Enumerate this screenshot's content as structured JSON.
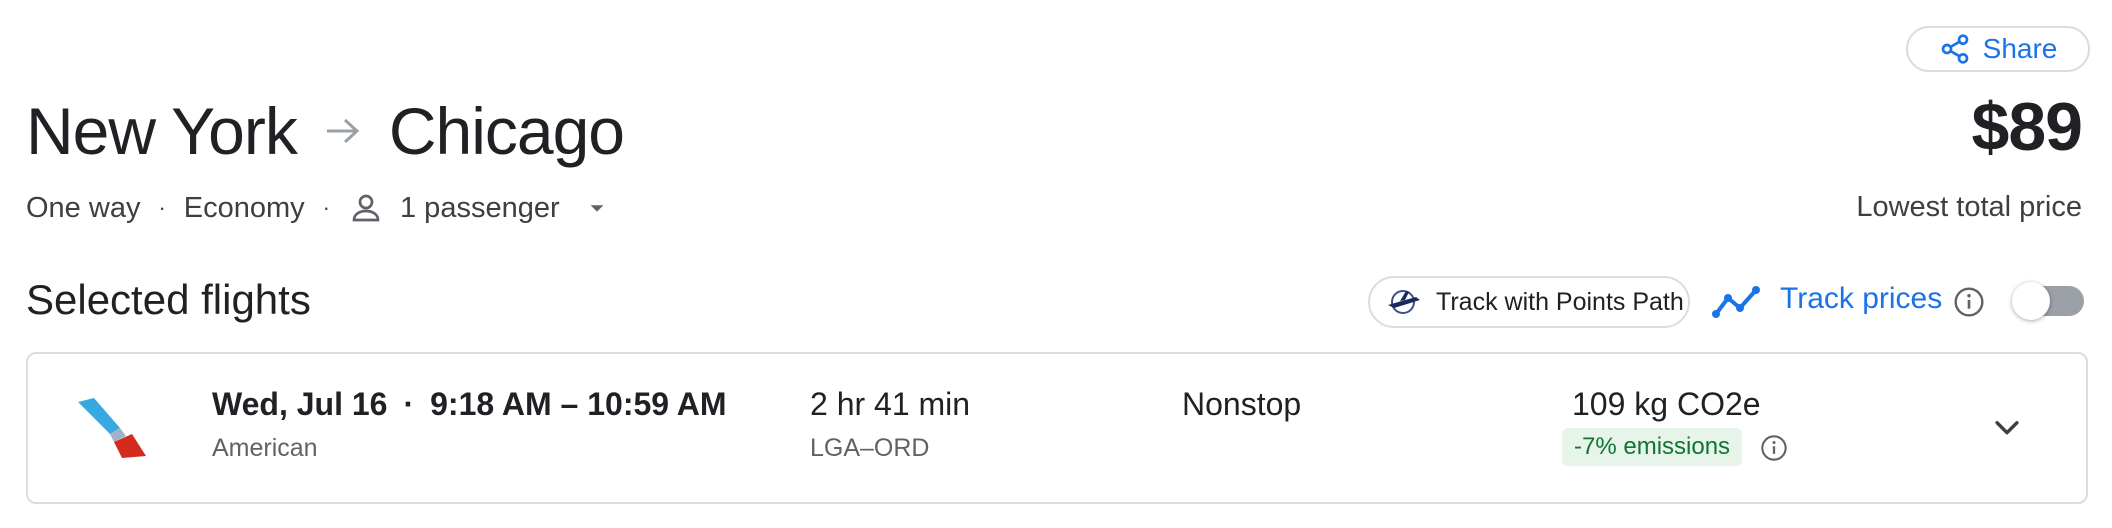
{
  "share": {
    "label": "Share",
    "icon": "share-icon"
  },
  "trip": {
    "origin": "New York",
    "destination": "Chicago",
    "arrow_icon": "arrow-right-icon",
    "trip_type": "One way",
    "cabin": "Economy",
    "passengers": "1 passenger"
  },
  "price": {
    "amount": "$89",
    "caption": "Lowest total price"
  },
  "section": {
    "title": "Selected flights"
  },
  "points_path": {
    "label": "Track with Points Path"
  },
  "track_prices": {
    "label": "Track prices",
    "enabled": false
  },
  "flight": {
    "date": "Wed, Jul 16",
    "times": "9:18 AM – 10:59 AM",
    "airline": "American",
    "duration": "2 hr 41 min",
    "route": "LGA–ORD",
    "stops": "Nonstop",
    "emissions": "109 kg CO2e",
    "emissions_delta": "-7% emissions"
  },
  "colors": {
    "accent": "#1a73e8",
    "emissions_badge_bg": "#e6f4ea",
    "emissions_badge_text": "#137333",
    "border": "#dadce0"
  }
}
